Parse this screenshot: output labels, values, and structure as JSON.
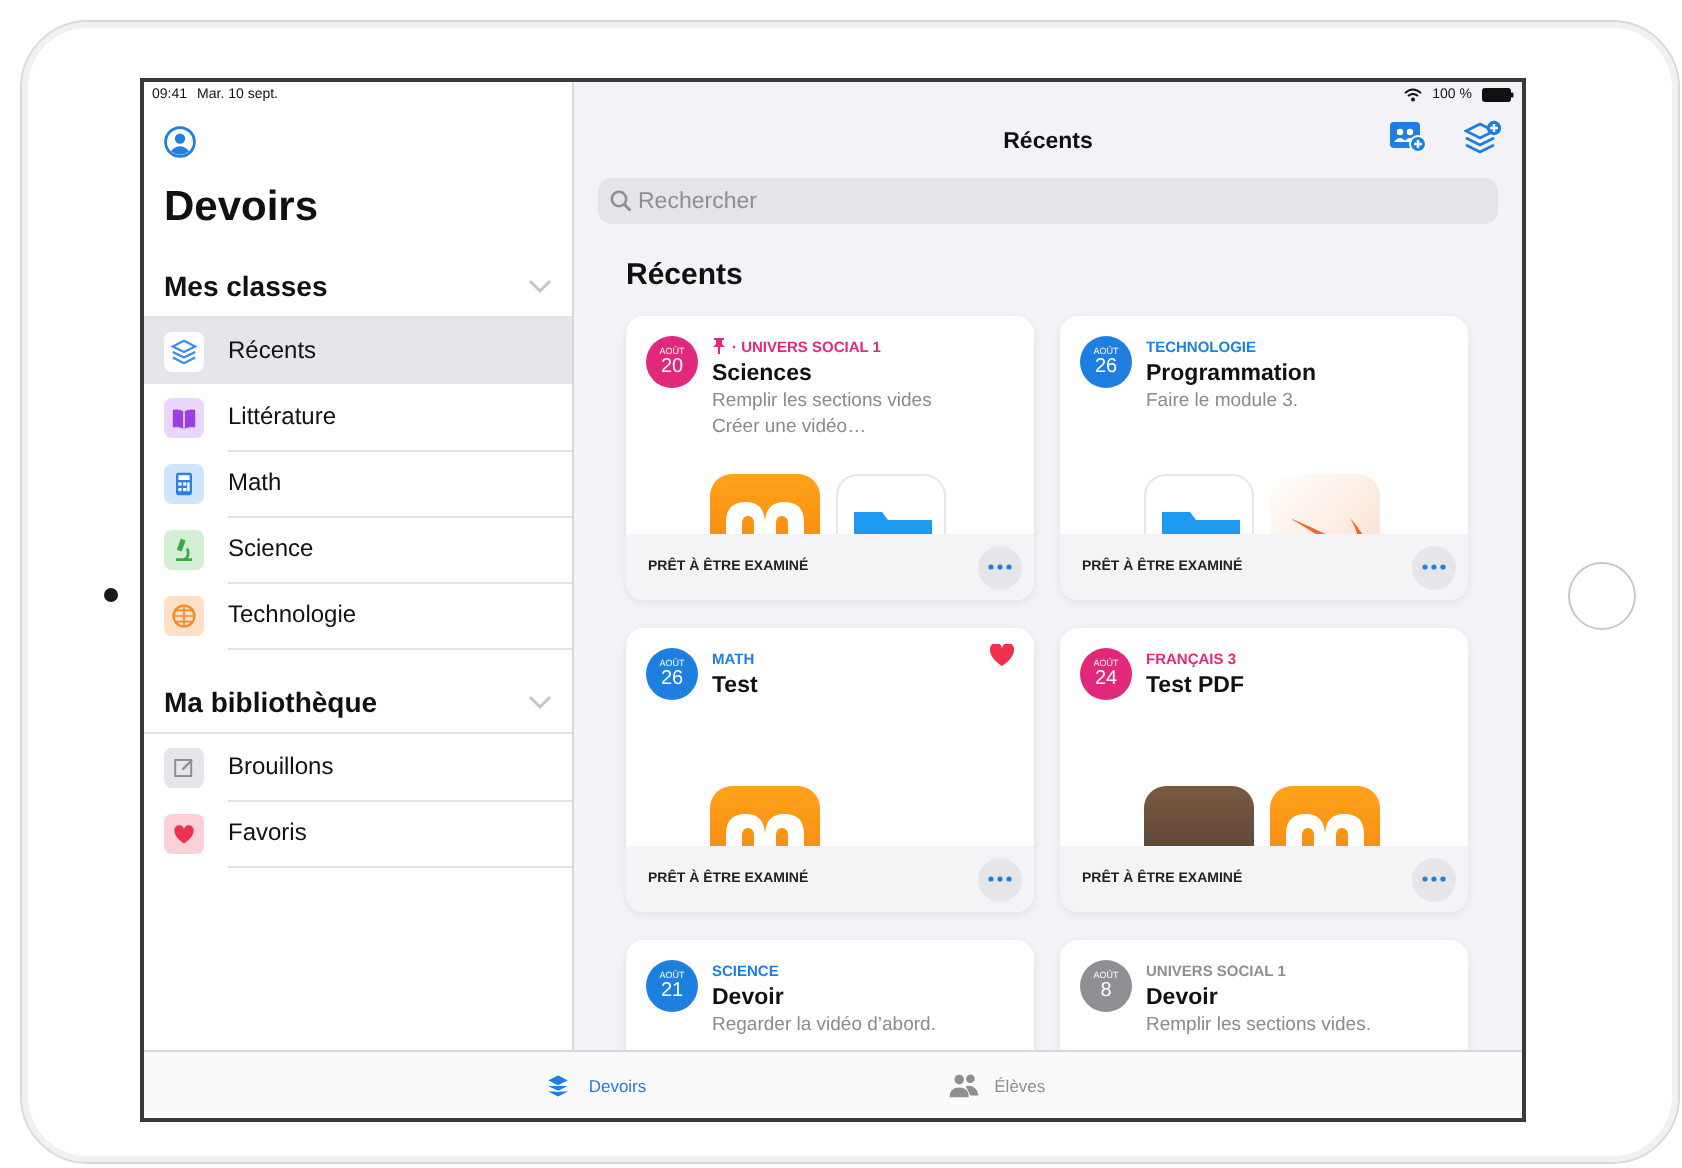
{
  "status_bar": {
    "time": "09:41",
    "date": "Mar. 10 sept.",
    "battery": "100 %"
  },
  "sidebar": {
    "title": "Devoirs",
    "sections": [
      {
        "title": "Mes classes",
        "expanded": true,
        "items": [
          {
            "label": "Récents",
            "selected": true,
            "kind": "stack",
            "color": "#3b8cf0"
          },
          {
            "label": "Littérature",
            "selected": false,
            "kind": "book",
            "color": "#9b3fe0"
          },
          {
            "label": "Math",
            "selected": false,
            "kind": "calculator",
            "color": "#2f7fe0"
          },
          {
            "label": "Science",
            "selected": false,
            "kind": "microscope",
            "color": "#3aa845"
          },
          {
            "label": "Technologie",
            "selected": false,
            "kind": "globe",
            "color": "#f08a24"
          }
        ]
      },
      {
        "title": "Ma bibliothèque",
        "expanded": true,
        "items": [
          {
            "label": "Brouillons",
            "selected": false,
            "kind": "draft",
            "color": "#8e8e93"
          },
          {
            "label": "Favoris",
            "selected": false,
            "kind": "heart",
            "color": "#f0304f"
          }
        ]
      }
    ]
  },
  "main": {
    "nav_title": "Récents",
    "search": {
      "placeholder": "Rechercher"
    },
    "heading": "Récents",
    "cards": [
      {
        "month": "AOÛT",
        "day": "20",
        "color": "#e2287a",
        "pinned": true,
        "favorite": false,
        "category": "· UNIVERS SOCIAL 1",
        "title": "Sciences",
        "lines": [
          "Remplir les sections vides",
          "Créer une vidéo…"
        ],
        "attachments": [
          {
            "kind": "books"
          },
          {
            "kind": "files"
          }
        ],
        "status": "PRÊT À ÊTRE EXAMINÉ"
      },
      {
        "month": "AOÛT",
        "day": "26",
        "color": "#1f7fe0",
        "pinned": false,
        "favorite": false,
        "category": "TECHNOLOGIE",
        "title": "Programmation",
        "lines": [
          "Faire le module 3."
        ],
        "attachments": [
          {
            "kind": "files"
          },
          {
            "kind": "swift"
          }
        ],
        "status": "PRÊT À ÊTRE EXAMINÉ"
      },
      {
        "month": "AOÛT",
        "day": "26",
        "color": "#1f7fe0",
        "pinned": false,
        "favorite": true,
        "category": "MATH",
        "title": "Test",
        "attachments": [
          {
            "kind": "books"
          }
        ],
        "status": "PRÊT À ÊTRE EXAMINÉ"
      },
      {
        "month": "AOÛT",
        "day": "24",
        "color": "#e2287a",
        "pinned": false,
        "favorite": false,
        "category": "FRANÇAIS 3",
        "title": "Test PDF",
        "attachments": [
          {
            "kind": "photo"
          },
          {
            "kind": "books"
          }
        ],
        "status": "PRÊT À ÊTRE EXAMINÉ"
      },
      {
        "month": "AOÛT",
        "day": "21",
        "color": "#1f7fe0",
        "pinned": false,
        "favorite": false,
        "category": "SCIENCE",
        "title": "Devoir",
        "lines": [
          "Regarder la vidéo d’abord."
        ]
      },
      {
        "month": "AOÛT",
        "day": "8",
        "color": "#8e8e93",
        "pinned": false,
        "favorite": false,
        "category": "UNIVERS SOCIAL 1",
        "title": "Devoir",
        "lines": [
          "Remplir les sections vides."
        ]
      }
    ]
  },
  "tab_bar": [
    {
      "label": "Devoirs",
      "kind": "stack",
      "selected": true
    },
    {
      "label": "Élèves",
      "kind": "people",
      "selected": false
    }
  ]
}
